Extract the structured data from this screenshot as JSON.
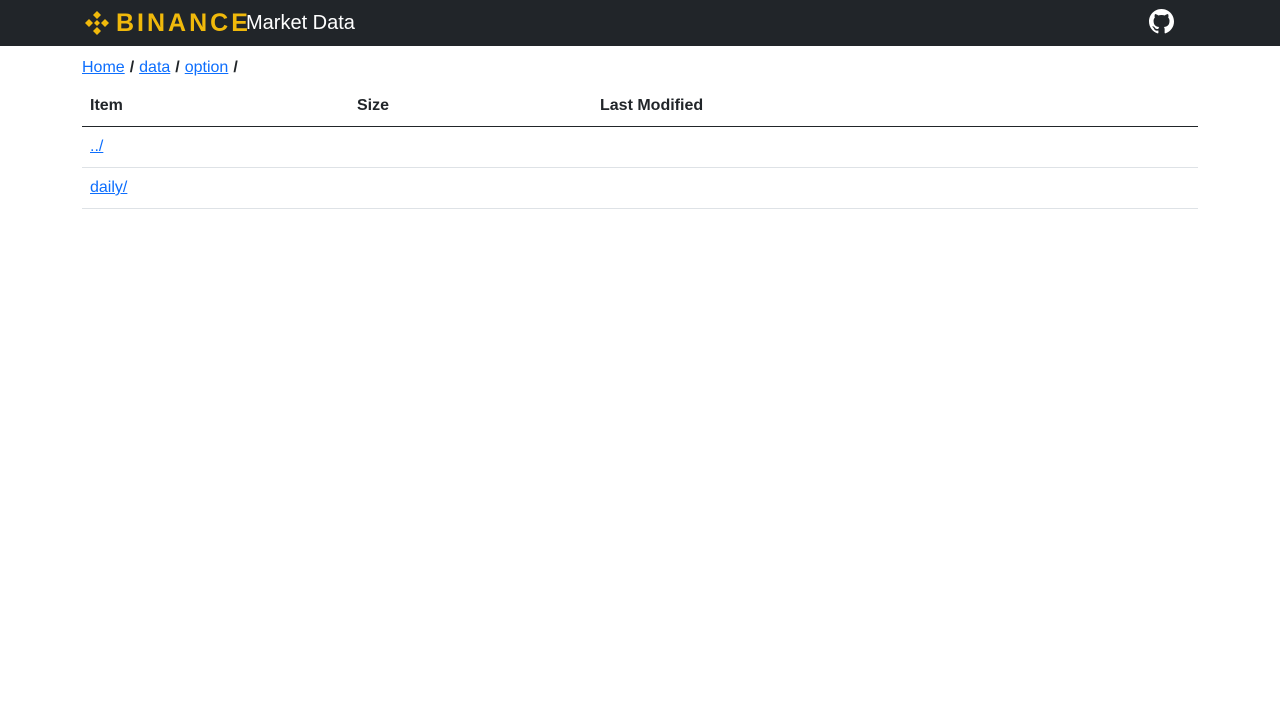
{
  "header": {
    "logo_text": "BINANCE",
    "title": "Market Data",
    "github_icon": "github-icon",
    "brand_color": "#F0B90B",
    "bar_color": "#212529"
  },
  "breadcrumb": {
    "items": [
      "Home",
      "data",
      "option"
    ],
    "separator": "/"
  },
  "table": {
    "headers": [
      "Item",
      "Size",
      "Last Modified"
    ],
    "rows": [
      {
        "item": "../",
        "size": "",
        "modified": ""
      },
      {
        "item": "daily/",
        "size": "",
        "modified": ""
      }
    ]
  },
  "link_color": "#0d6efd"
}
